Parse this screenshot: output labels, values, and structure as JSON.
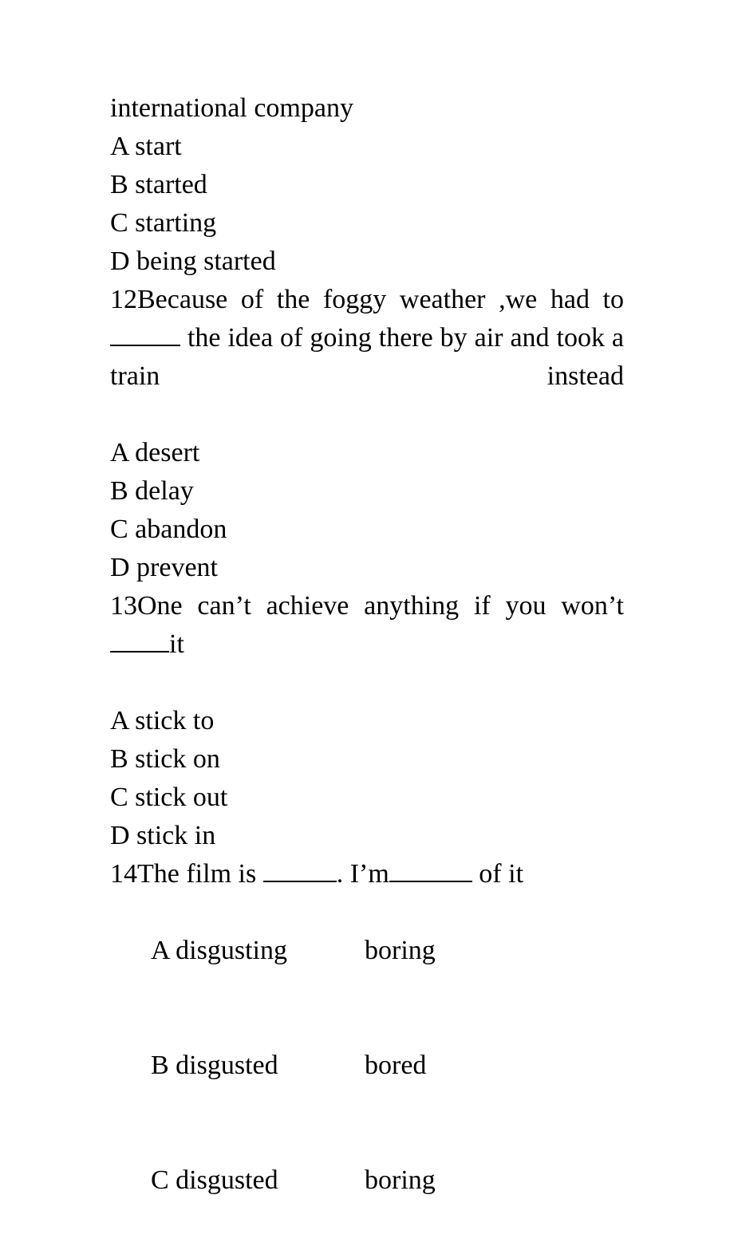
{
  "document": {
    "kind": "english-grammar-multiple-choice-exam",
    "continuation_line": "international company"
  },
  "continued_options": [
    "A start",
    "B started",
    "C starting",
    "D being started"
  ],
  "questions": [
    {
      "number": "12",
      "stem_part1": "12Because of the foggy weather ,we had to",
      "stem_part2": " the idea of going there by air and took a train instead",
      "options": [
        "A desert",
        "B delay",
        "C abandon",
        "D prevent"
      ]
    },
    {
      "number": "13",
      "stem_part1": "13One can’t achieve anything if you won’t ",
      "stem_part2": "it",
      "options": [
        "A stick to",
        "B stick on",
        "C stick out",
        "D stick in"
      ]
    },
    {
      "number": "14",
      "stem_part1": "14The film is ",
      "stem_part2": ". I’m",
      "stem_part3": " of it",
      "options_two_column": [
        {
          "left": "A disgusting",
          "right": "boring"
        },
        {
          "left": "B disgusted",
          "right": "bored"
        },
        {
          "left": "C disgusted",
          "right": "boring"
        }
      ]
    }
  ],
  "colors": {
    "page_background": "#ffffff",
    "text": "#000000",
    "blank_rule": "#000000"
  }
}
